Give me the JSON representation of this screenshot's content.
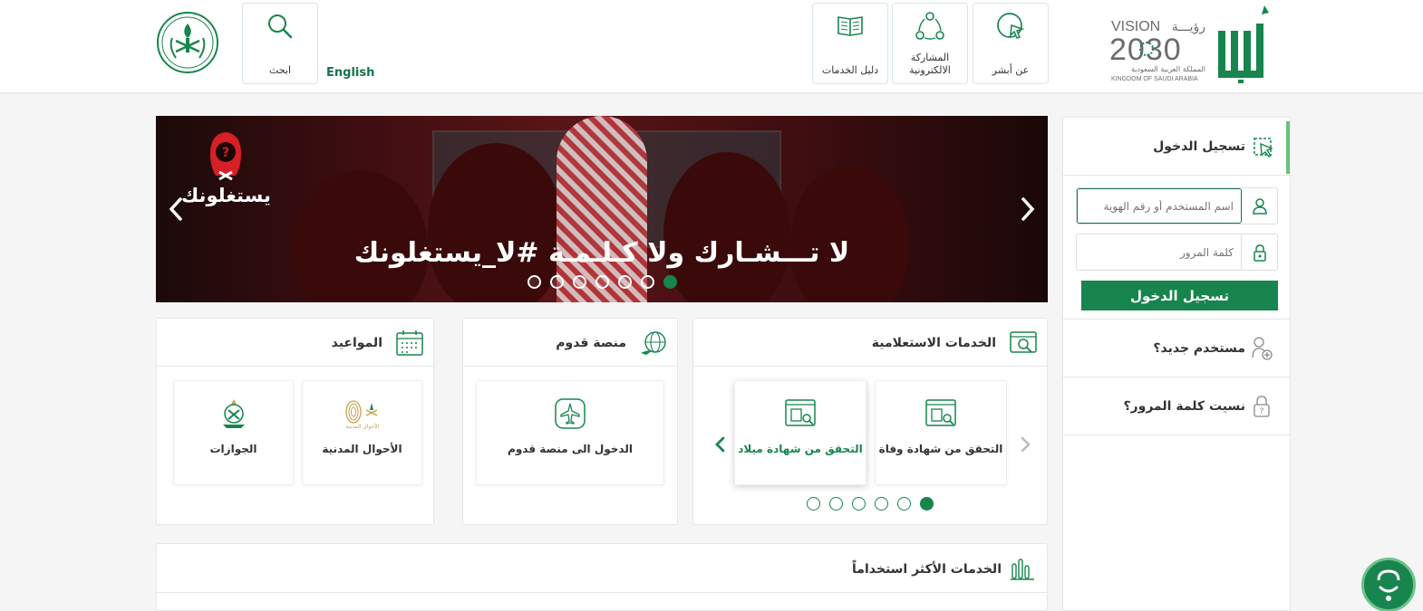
{
  "header": {
    "about_label": "عن أبشر",
    "eparticipation_label_line1": "المشاركة",
    "eparticipation_label_line2": "الالكترونية",
    "services_guide_label": "دليل الخدمات",
    "search_label": "ابحث",
    "language_link": "English",
    "vision_word": "VISION",
    "vision_arabic": "رؤيـــة",
    "vision_year": "2030",
    "vision_kingdom_ar": "المملكة العربية السعودية",
    "vision_kingdom_en": "KINGDOM OF SAUDI ARABIA",
    "brand_colors": {
      "primary": "#17854d",
      "dark": "#17724a",
      "accent_light": "#68c17c"
    }
  },
  "login": {
    "title": "تسجيل الدخول",
    "username_placeholder": "اسم المستخدم أو رقم الهوية",
    "password_placeholder": "كلمة المرور",
    "submit_label": "تسجيل الدخول",
    "new_user_label": "مستخدم جديد؟",
    "forgot_password_label": "نسيت كلمة المرور؟"
  },
  "banner": {
    "slogan": "لا تـــشـارك ولا كـلـمـة #لا_يستغلونك",
    "brand_text": "يستغلونك",
    "slides_total": 7,
    "active_slide": 7
  },
  "cards": {
    "inquiry": {
      "title": "الخدمات الاستعلامية",
      "tiles": [
        {
          "label": "التحقق من شهادة وفاة"
        },
        {
          "label": "التحقق من شهادة ميلاد"
        }
      ],
      "pages_total": 6,
      "active_page": 6
    },
    "arrival": {
      "title": "منصة قدوم",
      "tiles": [
        {
          "label": "الدخول الى منصة قدوم"
        }
      ]
    },
    "appointments": {
      "title": "المواعيد",
      "tiles": [
        {
          "label": "الأحوال المدنية"
        },
        {
          "label": "الجوازات"
        }
      ],
      "civil_affairs_logo_text": "الأحوال المدنية"
    }
  },
  "most_used": {
    "title": "الخدمات الأكثر استخداماً"
  }
}
